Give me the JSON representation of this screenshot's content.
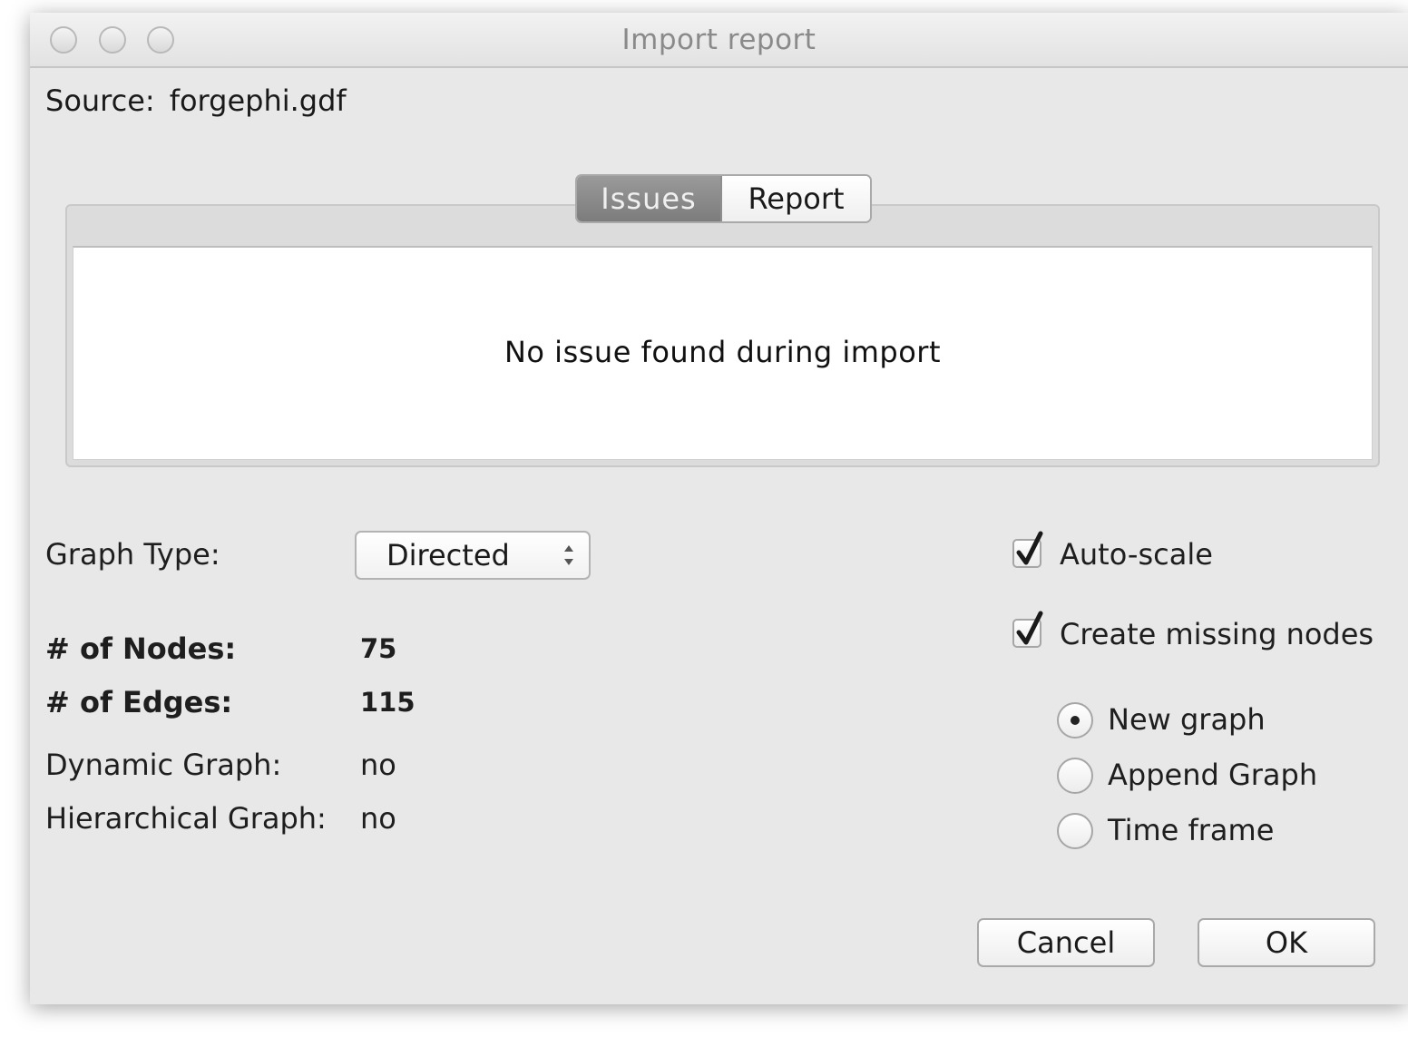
{
  "window": {
    "title": "Import report"
  },
  "source": {
    "label": "Source:",
    "value": "forgephi.gdf"
  },
  "tabs": [
    {
      "label": "Issues",
      "active": true
    },
    {
      "label": "Report",
      "active": false
    }
  ],
  "issues_panel": {
    "message": "No issue found during import"
  },
  "graph_type": {
    "label": "Graph Type:",
    "selected": "Directed"
  },
  "stats": {
    "nodes_label": "# of Nodes:",
    "nodes_value": "75",
    "edges_label": "# of Edges:",
    "edges_value": "115",
    "dynamic_label": "Dynamic Graph:",
    "dynamic_value": "no",
    "hierarchical_label": "Hierarchical Graph:",
    "hierarchical_value": "no"
  },
  "options": {
    "auto_scale": {
      "label": "Auto-scale",
      "checked": true
    },
    "create_missing_nodes": {
      "label": "Create missing nodes",
      "checked": true
    }
  },
  "mode": {
    "options": [
      {
        "label": "New graph",
        "selected": true
      },
      {
        "label": "Append Graph",
        "selected": false
      },
      {
        "label": "Time frame",
        "selected": false
      }
    ]
  },
  "buttons": {
    "cancel": "Cancel",
    "ok": "OK"
  },
  "colors": {
    "window_bg": "#e8e8e8",
    "active_tab": "#8a8a8a",
    "text": "#1e1e1e"
  }
}
